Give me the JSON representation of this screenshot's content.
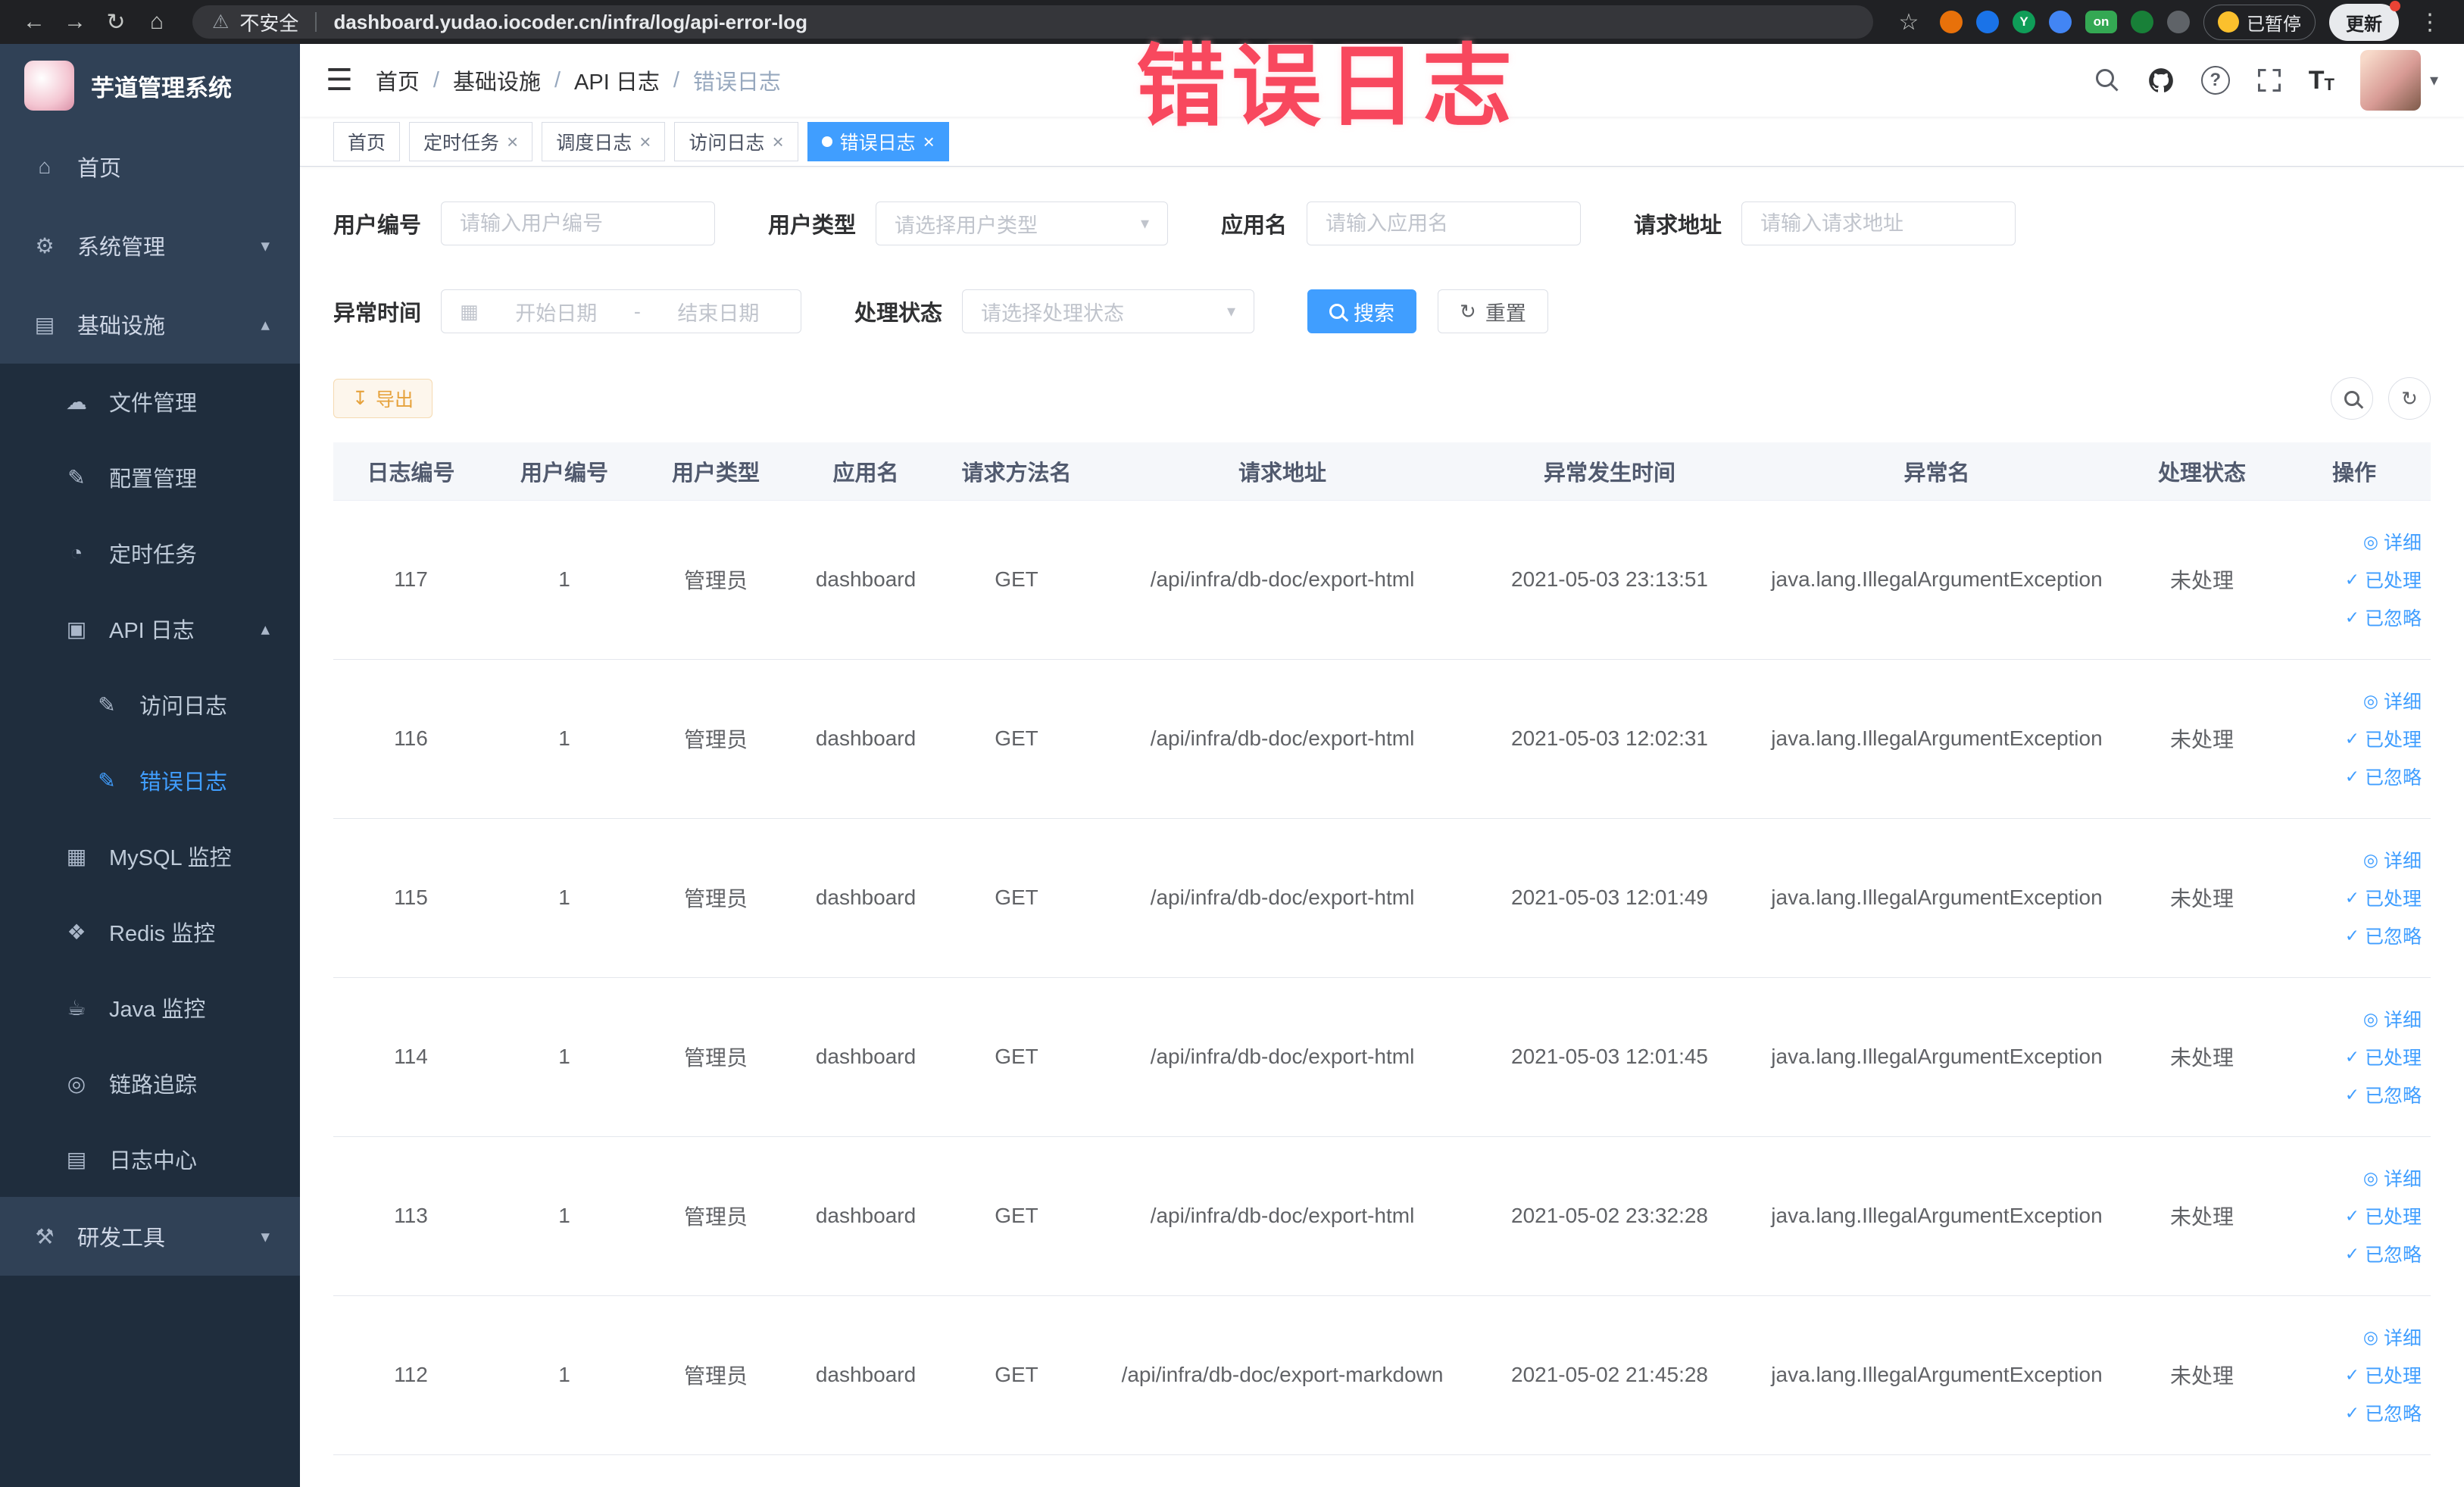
{
  "annotation": {
    "text": "错误日志"
  },
  "colors": {
    "primary": "#409eff",
    "sidebar_bg": "#304156",
    "sidebar_sub_bg": "#1f2d3d",
    "annotation": "#f8485e",
    "warning": "#e6a23c",
    "active_tab_bg": "#409eff"
  },
  "icons": {
    "back": "←",
    "forward": "→",
    "reload": "↻",
    "home": "⌂",
    "warning": "⚠",
    "star": "☆",
    "menu_dots": "⋮",
    "hamburger": "☰",
    "question": "?",
    "font_size": "T",
    "caret_down": "▾",
    "chevron_down": "▾",
    "chevron_up": "▴",
    "menu_home": "⌂",
    "menu_system": "⚙",
    "menu_infra": "▤",
    "menu_file": "☁",
    "menu_config": "✎",
    "menu_job": "◔",
    "menu_apilog": "▣",
    "menu_accesslog": "✎",
    "menu_errorlog": "✎",
    "menu_mysql": "▦",
    "menu_redis": "❖",
    "menu_java": "☕",
    "menu_trace": "◎",
    "menu_logcenter": "▤",
    "menu_devtool": "⚒",
    "calendar": "▦",
    "refresh": "↻",
    "download": "↧",
    "close": "×",
    "eye": "◎",
    "check": "✓"
  },
  "browser": {
    "security_label": "不安全",
    "url": "dashboard.yudao.iocoder.cn/infra/log/api-error-log",
    "extension_y": "Y",
    "extension_on": "on",
    "paused_badge": "已暂停",
    "update_button": "更新"
  },
  "sidebar": {
    "logo_title": "芋道管理系统",
    "items": [
      {
        "label": "首页"
      },
      {
        "label": "系统管理"
      },
      {
        "label": "基础设施"
      },
      {
        "label": "文件管理"
      },
      {
        "label": "配置管理"
      },
      {
        "label": "定时任务"
      },
      {
        "label": "API 日志"
      },
      {
        "label": "访问日志"
      },
      {
        "label": "错误日志"
      },
      {
        "label": "MySQL 监控"
      },
      {
        "label": "Redis 监控"
      },
      {
        "label": "Java 监控"
      },
      {
        "label": "链路追踪"
      },
      {
        "label": "日志中心"
      },
      {
        "label": "研发工具"
      }
    ]
  },
  "header": {
    "breadcrumb": [
      "首页",
      "基础设施",
      "API 日志",
      "错误日志"
    ],
    "separator": "/"
  },
  "tabs": [
    {
      "label": "首页"
    },
    {
      "label": "定时任务"
    },
    {
      "label": "调度日志"
    },
    {
      "label": "访问日志"
    },
    {
      "label": "错误日志"
    }
  ],
  "filters": {
    "user_id_label": "用户编号",
    "user_id_placeholder": "请输入用户编号",
    "user_type_label": "用户类型",
    "user_type_placeholder": "请选择用户类型",
    "app_name_label": "应用名",
    "app_name_placeholder": "请输入应用名",
    "request_url_label": "请求地址",
    "request_url_placeholder": "请输入请求地址",
    "exception_time_label": "异常时间",
    "date_start_placeholder": "开始日期",
    "date_separator": "-",
    "date_end_placeholder": "结束日期",
    "process_status_label": "处理状态",
    "process_status_placeholder": "请选择处理状态",
    "search_button": "搜索",
    "reset_button": "重置"
  },
  "toolbar": {
    "export_button": "导出"
  },
  "table": {
    "columns": [
      "日志编号",
      "用户编号",
      "用户类型",
      "应用名",
      "请求方法名",
      "请求地址",
      "异常发生时间",
      "异常名",
      "处理状态",
      "操作"
    ],
    "action_detail": "详细",
    "action_processed": "已处理",
    "action_ignored": "已忽略",
    "rows": [
      {
        "id": "117",
        "user_id": "1",
        "user_type": "管理员",
        "app": "dashboard",
        "method": "GET",
        "url": "/api/infra/db-doc/export-html",
        "time": "2021-05-03 23:13:51",
        "exception": "java.lang.IllegalArgumentException",
        "status": "未处理"
      },
      {
        "id": "116",
        "user_id": "1",
        "user_type": "管理员",
        "app": "dashboard",
        "method": "GET",
        "url": "/api/infra/db-doc/export-html",
        "time": "2021-05-03 12:02:31",
        "exception": "java.lang.IllegalArgumentException",
        "status": "未处理"
      },
      {
        "id": "115",
        "user_id": "1",
        "user_type": "管理员",
        "app": "dashboard",
        "method": "GET",
        "url": "/api/infra/db-doc/export-html",
        "time": "2021-05-03 12:01:49",
        "exception": "java.lang.IllegalArgumentException",
        "status": "未处理"
      },
      {
        "id": "114",
        "user_id": "1",
        "user_type": "管理员",
        "app": "dashboard",
        "method": "GET",
        "url": "/api/infra/db-doc/export-html",
        "time": "2021-05-03 12:01:45",
        "exception": "java.lang.IllegalArgumentException",
        "status": "未处理"
      },
      {
        "id": "113",
        "user_id": "1",
        "user_type": "管理员",
        "app": "dashboard",
        "method": "GET",
        "url": "/api/infra/db-doc/export-html",
        "time": "2021-05-02 23:32:28",
        "exception": "java.lang.IllegalArgumentException",
        "status": "未处理"
      },
      {
        "id": "112",
        "user_id": "1",
        "user_type": "管理员",
        "app": "dashboard",
        "method": "GET",
        "url": "/api/infra/db-doc/export-markdown",
        "time": "2021-05-02 21:45:28",
        "exception": "java.lang.IllegalArgumentException",
        "status": "未处理"
      }
    ]
  }
}
